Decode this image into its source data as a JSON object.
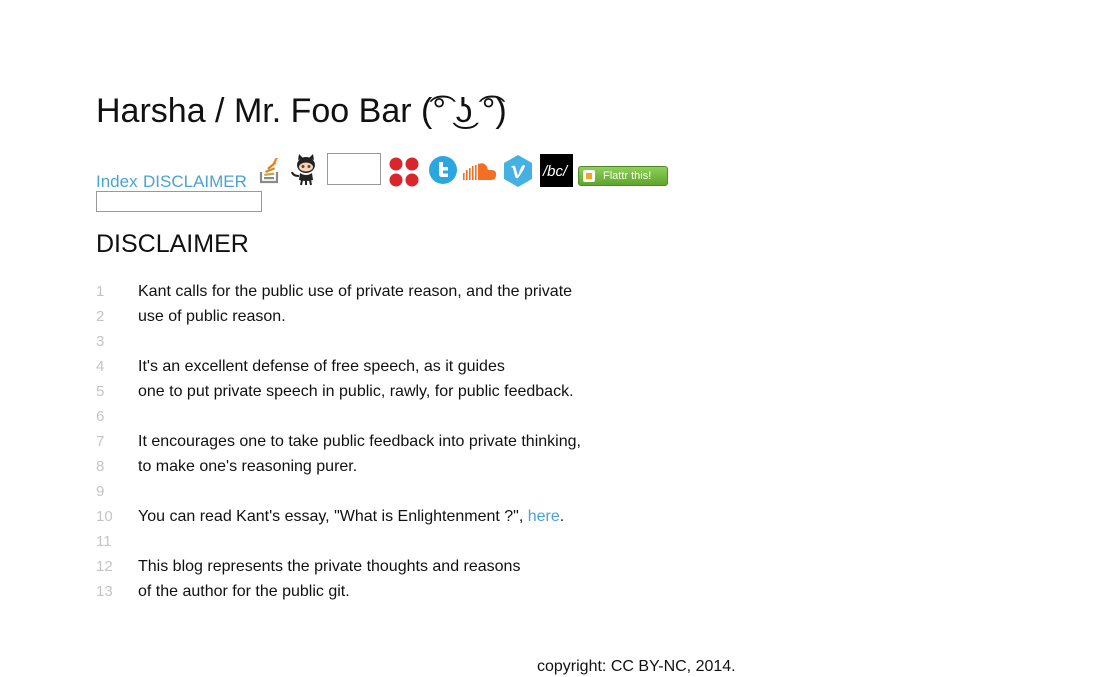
{
  "header": {
    "title": "Harsha / Mr. Foo Bar (͡° ͜ʖ ͡°)"
  },
  "nav": {
    "links": [
      {
        "label": "Index"
      },
      {
        "label": "DISCLAIMER"
      }
    ],
    "icons": [
      "stackoverflow-icon",
      "github-octocat-icon",
      "blank-badge",
      "flickr-dots-icon",
      "twitter-icon",
      "soundcloud-icon",
      "vimeo-icon",
      "bandcamp-icon",
      "flattr-button"
    ],
    "flattr_label": "Flattr this!"
  },
  "search": {
    "value": "",
    "placeholder": ""
  },
  "post": {
    "title": "DISCLAIMER",
    "lines": [
      {
        "num": "1",
        "text": "Kant calls for the public use of private reason, and the private"
      },
      {
        "num": "2",
        "text": "use of public reason."
      },
      {
        "num": "3",
        "text": ""
      },
      {
        "num": "4",
        "text": "It's an excellent defense of free speech, as it guides"
      },
      {
        "num": "5",
        "text": "one to put private speech in public, rawly, for public feedback."
      },
      {
        "num": "6",
        "text": ""
      },
      {
        "num": "7",
        "text": "It encourages one to take public feedback into private thinking,"
      },
      {
        "num": "8",
        "text": "to make one's reasoning purer."
      },
      {
        "num": "9",
        "text": ""
      },
      {
        "num": "10",
        "text_before": "You can read Kant's essay, \"What is Enlightenment ?\", ",
        "link": "here",
        "text_after": "."
      },
      {
        "num": "11",
        "text": ""
      },
      {
        "num": "12",
        "text": "This blog represents the private thoughts and reasons"
      },
      {
        "num": "13",
        "text": "of the author for the public git."
      }
    ]
  },
  "footer": {
    "copyright": "copyright: CC BY-NC, 2014."
  },
  "colors": {
    "link": "#4aa3d6",
    "line_number": "#c4c4c4",
    "twitter": "#2aa6e0",
    "soundcloud": "#f26f23",
    "vimeo": "#45b1e3",
    "flickr_dots": "#d9262a",
    "flattr_green": "#6cb23a"
  }
}
